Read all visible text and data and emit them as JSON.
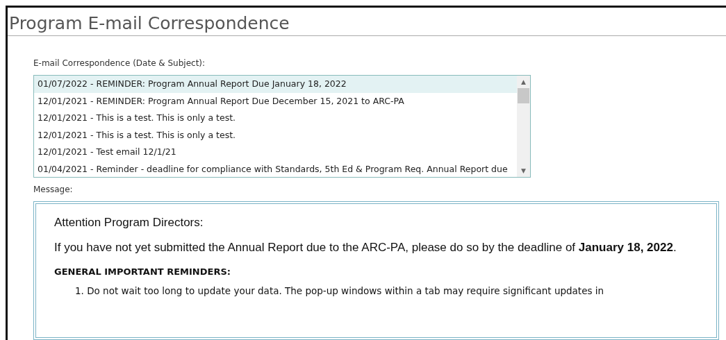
{
  "page_title": "Program E-mail Correspondence",
  "list_label": "E-mail Correspondence (Date & Subject):",
  "emails": [
    {
      "text": "01/07/2022 - REMINDER: Program Annual Report Due January 18, 2022",
      "selected": true
    },
    {
      "text": "12/01/2021 - REMINDER: Program Annual Report Due December 15, 2021 to ARC-PA",
      "selected": false
    },
    {
      "text": "12/01/2021 - This is a test. This is only a test.",
      "selected": false
    },
    {
      "text": "12/01/2021 - This is a test. This is only a test.",
      "selected": false
    },
    {
      "text": "12/01/2021 - Test email 12/1/21",
      "selected": false
    },
    {
      "text": "01/04/2021 - Reminder - deadline for compliance with Standards, 5th Ed & Program Req. Annual Report due",
      "selected": false
    }
  ],
  "scroll_up": "▲",
  "scroll_down": "▼",
  "message_label": "Message:",
  "message": {
    "greeting": "Attention Program Directors:",
    "body": "If you have not yet submitted the Annual Report due to the ARC-PA, please do so by the deadline of **January 18, 2022**.",
    "heading": "GENERAL IMPORTANT REMINDERS:",
    "items": [
      {
        "number": "1.",
        "text": "Do not wait too long to update your data. The pop-up windows within a tab may require significant updates in"
      }
    ]
  }
}
